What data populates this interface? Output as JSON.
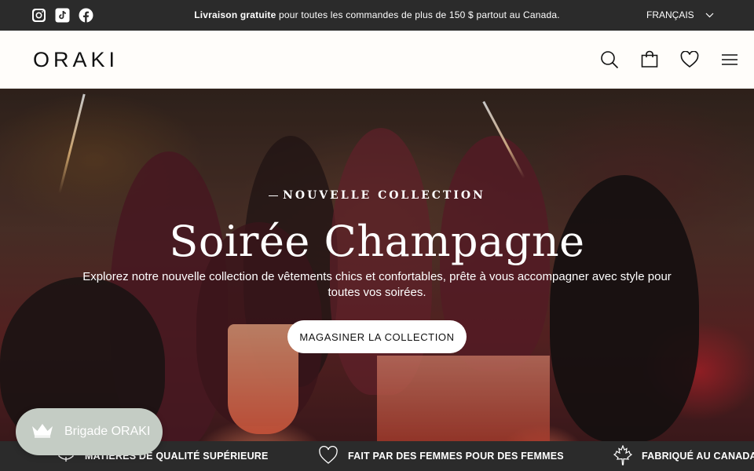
{
  "announcement": {
    "bold": "Livraison gratuite",
    "rest": " pour toutes les commandes de plus de 150 $ partout au Canada.",
    "language": "FRANÇAIS"
  },
  "socials": [
    "instagram-icon",
    "tiktok-icon",
    "facebook-icon"
  ],
  "header": {
    "logo": "ORAKI",
    "icons": [
      "search-icon",
      "shopping-bag-icon",
      "heart-icon",
      "menu-icon"
    ]
  },
  "hero": {
    "kicker": "NOUVELLE COLLECTION",
    "title": "Soirée Champagne",
    "subtitle": "Explorez notre nouvelle collection de vêtements chics et confortables, prête à vous accompagner avec style pour toutes vos soirées.",
    "cta": "MAGASINER LA COLLECTION"
  },
  "features": [
    {
      "icon": "fabric-icon",
      "label": "MATIÈRES DE QUALITÉ SUPÉRIEURE"
    },
    {
      "icon": "heart-outline-icon",
      "label": "FAIT PAR DES FEMMES POUR DES FEMMES"
    },
    {
      "icon": "maple-leaf-icon",
      "label": "FABRIQUÉ AU CANADA"
    }
  ],
  "loyalty": {
    "label": "Brigade ORAKI",
    "icon": "crown-icon"
  },
  "colors": {
    "bar": "#2b2b2b",
    "header_bg": "#fffdfa",
    "loyalty_bg": "#c4ccc4"
  }
}
